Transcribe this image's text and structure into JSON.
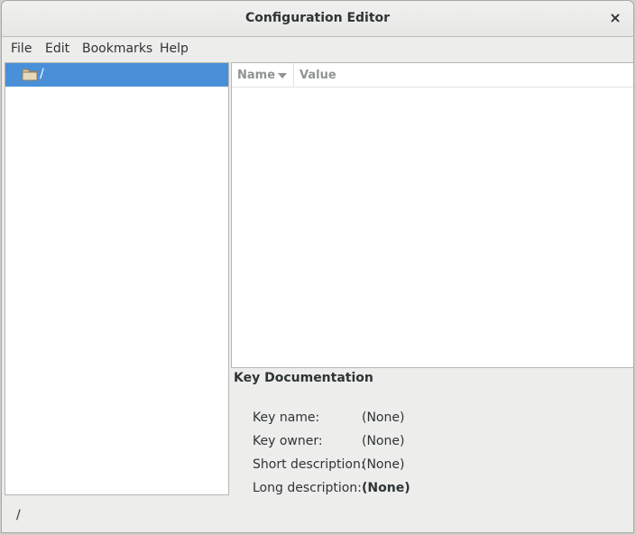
{
  "window": {
    "title": "Configuration Editor",
    "close_glyph": "×"
  },
  "menu": {
    "items": [
      "File",
      "Edit",
      "Bookmarks",
      "Help"
    ]
  },
  "tree": {
    "items": [
      {
        "label": "/",
        "icon": "folder-icon",
        "selected": true
      }
    ]
  },
  "list": {
    "columns": {
      "name": "Name",
      "value": "Value"
    },
    "sort": "name-descending"
  },
  "doc": {
    "title": "Key Documentation",
    "rows": [
      {
        "label": "Key name:",
        "value": "(None)"
      },
      {
        "label": "Key owner:",
        "value": "(None)"
      },
      {
        "label": "Short description:",
        "value": "(None)"
      },
      {
        "label": "Long description:",
        "value": "(None)"
      }
    ]
  },
  "status": {
    "path": "/"
  },
  "colors": {
    "selection": "#4a90d9",
    "background": "#ededeb"
  }
}
